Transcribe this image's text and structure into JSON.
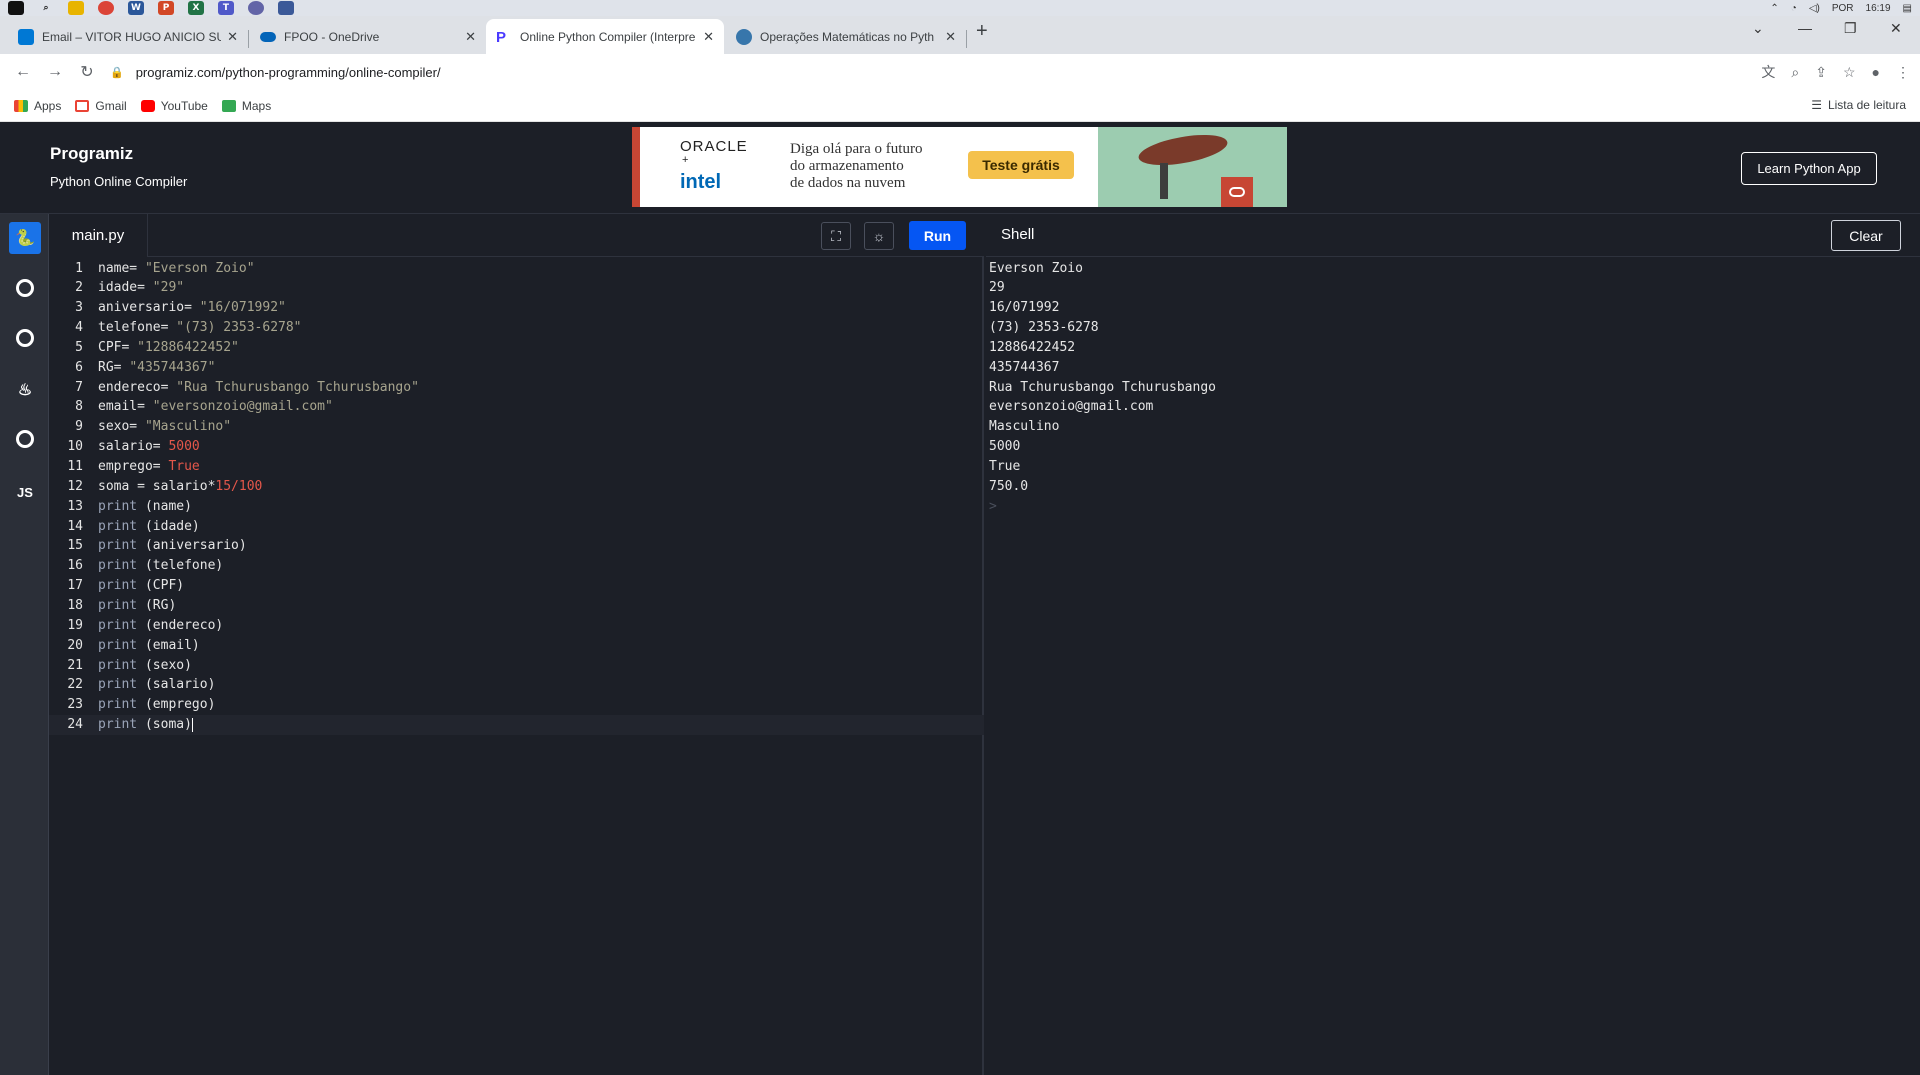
{
  "os": {
    "tray_lang": "POR",
    "tray_time": "16:19"
  },
  "browser": {
    "tabs": [
      {
        "title": "Email – VITOR HUGO ANICIO SU"
      },
      {
        "title": "FPOO - OneDrive"
      },
      {
        "title": "Online Python Compiler (Interpre"
      },
      {
        "title": "Operações Matemáticas no Pyth"
      }
    ],
    "url": "programiz.com/python-programming/online-compiler/",
    "bookmarks": [
      {
        "label": "Apps"
      },
      {
        "label": "Gmail"
      },
      {
        "label": "YouTube"
      },
      {
        "label": "Maps"
      }
    ],
    "reading_list": "Lista de leitura"
  },
  "header": {
    "logo": "Programiz",
    "subtitle": "Python Online Compiler",
    "learn_button": "Learn Python App"
  },
  "ad": {
    "brand1": "ORACLE",
    "plus": "+",
    "brand2": "intel",
    "copy_line1": "Diga olá para o futuro",
    "copy_line2": "do armazenamento",
    "copy_line3": "de dados na nuvem",
    "cta": "Teste grátis"
  },
  "languages": [
    {
      "icon": "python-icon",
      "label": "",
      "active": true
    },
    {
      "icon": "c-icon",
      "label": "C"
    },
    {
      "icon": "cpp-icon",
      "label": "C"
    },
    {
      "icon": "java-icon",
      "label": ""
    },
    {
      "icon": "csharp-icon",
      "label": "C"
    },
    {
      "icon": "javascript-icon",
      "label": "JS"
    }
  ],
  "editor": {
    "file_name": "main.py",
    "run_label": "Run",
    "lines": [
      {
        "n": "1",
        "a": "name= ",
        "s": "\"Everson Zoio\""
      },
      {
        "n": "2",
        "a": "idade= ",
        "s": "\"29\""
      },
      {
        "n": "3",
        "a": "aniversario= ",
        "s": "\"16/071992\""
      },
      {
        "n": "4",
        "a": "telefone= ",
        "s": "\"(73) 2353-6278\""
      },
      {
        "n": "5",
        "a": "CPF= ",
        "s": "\"12886422452\""
      },
      {
        "n": "6",
        "a": "RG= ",
        "s": "\"435744367\""
      },
      {
        "n": "7",
        "a": "endereco= ",
        "s": "\"Rua Tchurusbango Tchurusbango\""
      },
      {
        "n": "8",
        "a": "email= ",
        "s": "\"eversonzoio@gmail.com\""
      },
      {
        "n": "9",
        "a": "sexo= ",
        "s": "\"Masculino\""
      },
      {
        "n": "10",
        "a": "salario= ",
        "num": "5000"
      },
      {
        "n": "11",
        "a": "emprego= ",
        "num": "True"
      },
      {
        "n": "12",
        "a": "soma = salario*",
        "num": "15/100"
      },
      {
        "n": "13",
        "kw": "print",
        "a": " (name)"
      },
      {
        "n": "14",
        "kw": "print",
        "a": " (idade)"
      },
      {
        "n": "15",
        "kw": "print",
        "a": " (aniversario)"
      },
      {
        "n": "16",
        "kw": "print",
        "a": " (telefone)"
      },
      {
        "n": "17",
        "kw": "print",
        "a": " (CPF)"
      },
      {
        "n": "18",
        "kw": "print",
        "a": " (RG)"
      },
      {
        "n": "19",
        "kw": "print",
        "a": " (endereco)"
      },
      {
        "n": "20",
        "kw": "print",
        "a": " (email)"
      },
      {
        "n": "21",
        "kw": "print",
        "a": " (sexo)"
      },
      {
        "n": "22",
        "kw": "print",
        "a": " (salario)"
      },
      {
        "n": "23",
        "kw": "print",
        "a": " (emprego)"
      },
      {
        "n": "24",
        "kw": "print",
        "a": " (soma)",
        "cursor": true
      }
    ]
  },
  "shell": {
    "title": "Shell",
    "clear_label": "Clear",
    "output": [
      "Everson Zoio",
      "29",
      "16/071992",
      "(73) 2353-6278",
      "12886422452",
      "435744367",
      "Rua Tchurusbango Tchurusbango",
      "eversonzoio@gmail.com",
      "Masculino",
      "5000",
      "True",
      "750.0"
    ],
    "prompt": ">"
  },
  "colors": {
    "run_button": "#0556f3",
    "active_language": "#1a73e8",
    "editor_bg": "#1c1f27",
    "ad_cta": "#f4c14c"
  }
}
